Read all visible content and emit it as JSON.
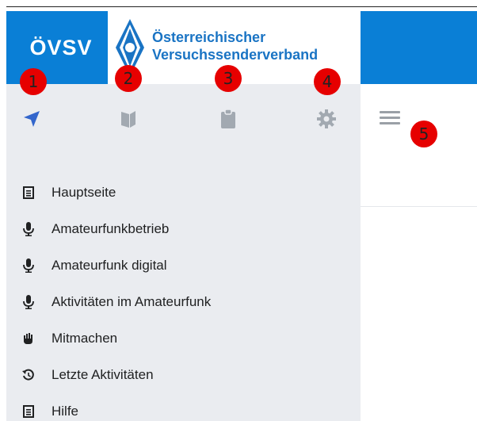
{
  "header": {
    "logo_short": "ÖVSV",
    "logo_line1": "Österreichischer",
    "logo_line2": "Versuchssenderverband",
    "brand_color": "#0a7fd6"
  },
  "tabs": [
    {
      "icon": "navigation-arrow-icon",
      "badge": "1"
    },
    {
      "icon": "book-icon",
      "badge": "2"
    },
    {
      "icon": "clipboard-icon",
      "badge": "3"
    },
    {
      "icon": "gear-icon",
      "badge": "4"
    }
  ],
  "main": {
    "menu_badge": "5"
  },
  "nav": [
    {
      "label": "Hauptseite",
      "icon": "document-icon"
    },
    {
      "label": "Amateurfunkbetrieb",
      "icon": "microphone-icon"
    },
    {
      "label": "Amateurfunk digital",
      "icon": "microphone-icon"
    },
    {
      "label": "Aktivitäten im Amateurfunk",
      "icon": "microphone-icon"
    },
    {
      "label": "Mitmachen",
      "icon": "hand-icon"
    },
    {
      "label": "Letzte Aktivitäten",
      "icon": "history-icon"
    },
    {
      "label": "Hilfe",
      "icon": "document-icon"
    }
  ],
  "colors": {
    "active_icon": "#36c",
    "inactive_icon": "#a2a9b1",
    "badge": "#e60000"
  }
}
